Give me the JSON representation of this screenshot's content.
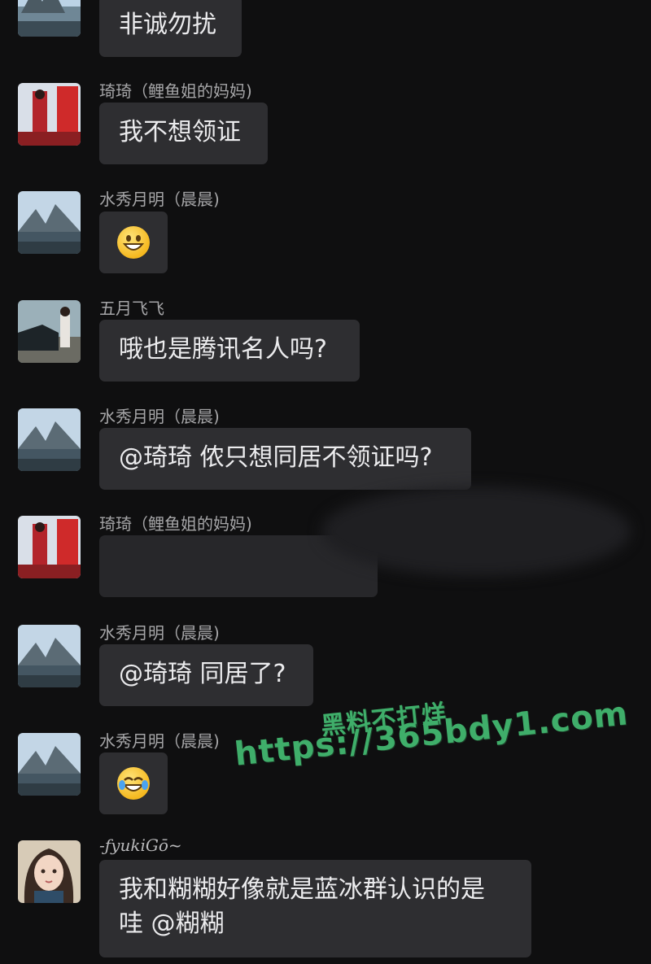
{
  "messages": [
    {
      "id": "m0",
      "sender": "",
      "avatar": "landscape-avatar",
      "text": "非诚勿扰"
    },
    {
      "id": "m1",
      "sender": "琦琦（鲤鱼姐的妈妈)",
      "avatar": "red-dress-avatar",
      "text": "我不想领证"
    },
    {
      "id": "m2",
      "sender": "水秀月明（晨晨)",
      "avatar": "landscape-avatar",
      "emoji": "grinning-face"
    },
    {
      "id": "m3",
      "sender": "五月飞飞",
      "avatar": "car-avatar",
      "text": "哦也是腾讯名人吗?"
    },
    {
      "id": "m4",
      "sender": "水秀月明（晨晨)",
      "avatar": "landscape-avatar",
      "text": "@琦琦 侬只想同居不领证吗?"
    },
    {
      "id": "m5",
      "sender": "琦琦（鲤鱼姐的妈妈)",
      "avatar": "red-dress-avatar",
      "text": ""
    },
    {
      "id": "m6",
      "sender": "水秀月明（晨晨)",
      "avatar": "landscape-avatar",
      "text": "@琦琦 同居了?"
    },
    {
      "id": "m7",
      "sender": "水秀月明（晨晨)",
      "avatar": "landscape-avatar",
      "emoji": "tears-of-joy-face"
    },
    {
      "id": "m8",
      "sender": "-ƒyukiGō~",
      "avatar": "anime-girl-avatar",
      "text_lines": [
        "我和糊糊好像就是蓝冰群认识的是",
        "哇 @糊糊"
      ]
    }
  ],
  "watermark": {
    "line1": "黑料不打烊",
    "line2": "https://365bdy1.com",
    "color": "#3fae6a"
  },
  "colors": {
    "background": "#0f0f10",
    "bubble": "#2e2e31",
    "name": "#a6a6a8",
    "text": "#ececee"
  }
}
